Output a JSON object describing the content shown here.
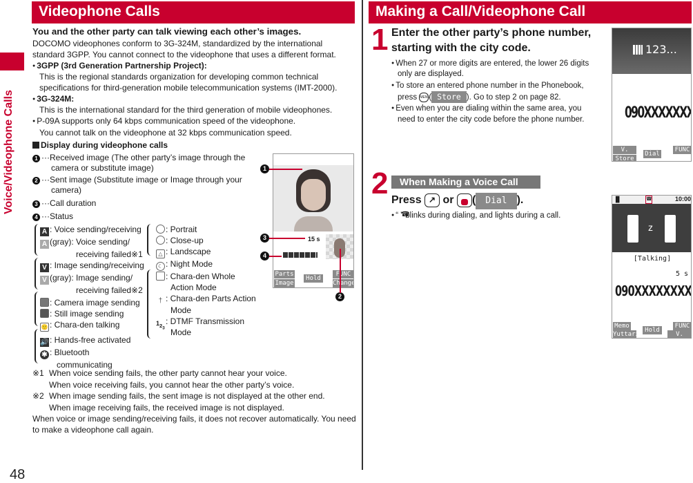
{
  "sidebar": {
    "section_label": "Voice/Videophone Calls",
    "page_number": "48"
  },
  "left": {
    "title": "Videophone Calls",
    "lead": "You and the other party can talk viewing each other’s images.",
    "intro_1": "DOCOMO videophones conform to 3G-324M, standardized by the international",
    "intro_2": "standard 3GPP. You cannot connect to the videophone that uses a different format.",
    "bullets": [
      {
        "head": "3GPP (3rd Generation Partnership Project):",
        "lines": [
          "This is the regional standards organization for developing common technical",
          "specifications for third-generation mobile telecommunication systems (IMT-2000)."
        ]
      },
      {
        "head": "3G-324M:",
        "lines": [
          "This is the international standard for the third generation of mobile videophones."
        ]
      }
    ],
    "note_1": "P-09A supports only 64 kbps communication speed of the videophone.",
    "note_2": "You cannot talk on the videophone at 32 kbps communication speed.",
    "display_heading": "Display during videophone calls",
    "legend": [
      {
        "num": "1",
        "text_1": "···Received image (The other party’s image through the",
        "text_2": "camera or substitute image)"
      },
      {
        "num": "2",
        "text_1": "···Sent image (Substitute image or Image through your",
        "text_2": "camera)"
      },
      {
        "num": "3",
        "text_1": "···Call duration",
        "text_2": ""
      },
      {
        "num": "4",
        "text_1": "···Status",
        "text_2": ""
      }
    ],
    "status_left": [
      {
        "icon": "A",
        "text": ": Voice sending/receiving"
      },
      {
        "icon": "A",
        "text": "(gray): Voice sending/"
      },
      {
        "icon": "",
        "text": "receiving failed※1"
      },
      {
        "icon": "V",
        "text": ": Image sending/receiving"
      },
      {
        "icon": "V",
        "text": "(gray): Image sending/"
      },
      {
        "icon": "",
        "text": "receiving failed※2"
      },
      {
        "icon": "cam",
        "text": ": Camera image sending"
      },
      {
        "icon": "still",
        "text": ": Still image sending"
      },
      {
        "icon": "chara",
        "text": ": Chara-den talking"
      },
      {
        "icon": "hf",
        "text": ": Hands-free activated"
      },
      {
        "icon": "bt",
        "text": ": Bluetooth"
      },
      {
        "icon": "",
        "text": "communicating"
      }
    ],
    "status_right": [
      {
        "text": ": Portrait"
      },
      {
        "text": ": Close-up"
      },
      {
        "text": ": Landscape"
      },
      {
        "text": ": Night Mode"
      },
      {
        "text": ": Chara-den Whole"
      },
      {
        "text": "Action Mode"
      },
      {
        "text": ": Chara-den Parts Action"
      },
      {
        "text": "Mode"
      },
      {
        "text": ": DTMF Transmission"
      },
      {
        "text": "Mode"
      }
    ],
    "footnotes": [
      {
        "mark": "※1",
        "line_1": "When voice sending fails, the other party cannot hear your voice.",
        "line_2": "When voice receiving fails, you cannot hear the other party’s voice."
      },
      {
        "mark": "※2",
        "line_1": "When image sending fails, the sent image is not displayed at the other end.",
        "line_2": "When image receiving fails, the received image is not displayed."
      }
    ],
    "closing_1": "When voice or image sending/receiving fails, it does not recover automatically. You need",
    "closing_2": "to make a videophone call again.",
    "phone": {
      "duration": "15 s",
      "softkeys": {
        "top_left": "Parts",
        "bottom_left": "Image",
        "center": "Hold",
        "top_right": "FUNC",
        "bottom_right": "Change"
      },
      "callouts": [
        "1",
        "2",
        "3",
        "4"
      ]
    }
  },
  "right": {
    "title": "Making a Call/Videophone Call",
    "step1": {
      "num": "1",
      "title_1": "Enter the other party’s phone number,",
      "title_2": "starting with the city code.",
      "b1_1": "When 27 or more digits are entered, the lower 26 digits",
      "b1_2": "only are displayed.",
      "b2_1": "To store an entered phone number in the Phonebook,",
      "b2_press": "press",
      "b2_key": "MENU",
      "b2_soft": "Store",
      "b2_rest": "). Go to step 2 on page 82.",
      "b3_1": "Even when you are dialing within the same area, you",
      "b3_2": "need to enter the city code before the phone number.",
      "phone": {
        "header": "123...",
        "number": "090XXXXXXXX",
        "softkeys": {
          "top_left": "V. phone",
          "bottom_left": "Store",
          "center": "Dial",
          "top_right": "FUNC"
        }
      }
    },
    "step2": {
      "num": "2",
      "banner": "When Making a Voice Call",
      "press": "Press",
      "or": "or",
      "soft": "Dial",
      "close": ").",
      "open": "(",
      "bullet": "“  ” blinks during dialing, and lights during a call.",
      "phone": {
        "time": "10:00",
        "status": "[Talking]",
        "duration": "5 s",
        "number": "090XXXXXXXX",
        "softkeys": {
          "top_left": "Memo",
          "bottom_left": "Yuttari",
          "center": "Hold",
          "top_right": "FUNC",
          "bottom_right": "V. phone"
        }
      }
    }
  }
}
